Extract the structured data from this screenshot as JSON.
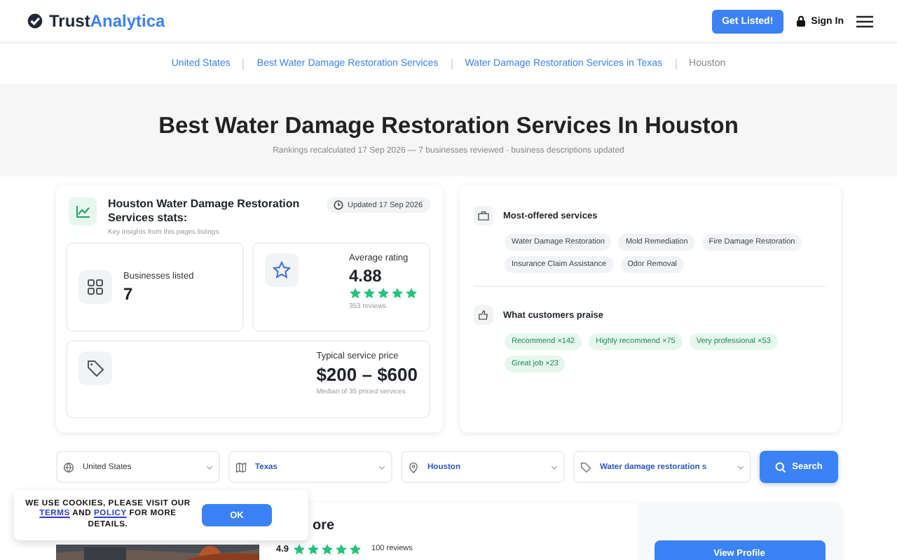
{
  "header": {
    "logo_text": "Trust",
    "logo_accent": "Analytica",
    "cta": "Get Listed!",
    "sign_in": "Sign In"
  },
  "breadcrumbs": [
    {
      "label": "United States",
      "current": false
    },
    {
      "label": "Best Water Damage Restoration Services",
      "current": false
    },
    {
      "label": "Water Damage Restoration Services in Texas",
      "current": false
    },
    {
      "label": "Houston",
      "current": true
    }
  ],
  "hero": {
    "title": "Best Water Damage Restoration Services In Houston",
    "subtitle": "Rankings recalculated 17 Sep 2026 — 7 businesses reviewed · business descriptions updated"
  },
  "stats": {
    "title": "Houston Water Damage Restoration Services stats:",
    "subtitle": "Key insights from this pages listings",
    "updated": "Updated  17 Sep 2026",
    "businesses": {
      "label": "Businesses listed",
      "value": "7"
    },
    "rating": {
      "label": "Average rating",
      "value": "4.88",
      "stars": 5,
      "reviews": "353 reviews"
    },
    "price": {
      "label": "Typical service price",
      "value": "$200 – $600",
      "note": "Median of 35 priced services"
    }
  },
  "services": {
    "title": "Most-offered services",
    "tags": [
      "Water Damage Restoration",
      "Mold Remediation",
      "Fire Damage Restoration",
      "Insurance Claim Assistance",
      "Odor Removal"
    ]
  },
  "praise": {
    "title": "What customers praise",
    "tags": [
      "Recommend ×142",
      "Highly recommend ×75",
      "Very professional ×53",
      "Great job ×23"
    ]
  },
  "filters": [
    {
      "kind": "globe",
      "value": "United States",
      "active": false
    },
    {
      "kind": "map",
      "value": "Texas",
      "active": true
    },
    {
      "kind": "pin",
      "value": "Houston",
      "active": true
    },
    {
      "kind": "tag",
      "value": "Water damage restoration s",
      "active": true
    }
  ],
  "search_button": "Search",
  "listing": {
    "title": "ore",
    "rating": "4.9",
    "stars": 5,
    "reviews": "100 reviews",
    "button": "View Profile"
  },
  "cookie": {
    "before": "WE USE COOKIES, PLEASE VISIT OUR",
    "terms": "TERMS",
    "middle": "AND",
    "policy": "POLICY",
    "after": "FOR MORE DETAILS.",
    "button": "OK"
  }
}
